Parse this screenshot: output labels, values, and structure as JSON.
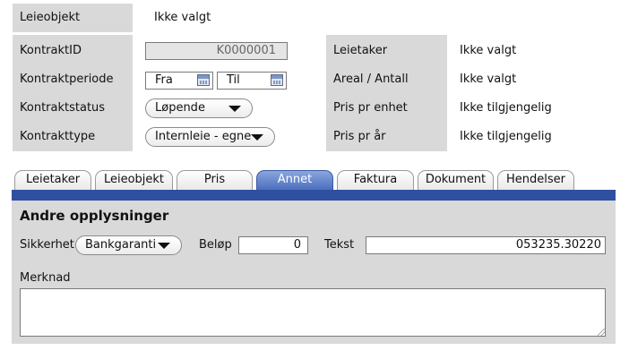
{
  "top": {
    "leieobjekt_label": "Leieobjekt",
    "leieobjekt_value": "Ikke valgt"
  },
  "left": {
    "kontraktid_label": "KontraktID",
    "kontraktid_value": "K0000001",
    "periode_label": "Kontraktperiode",
    "fra_label": "Fra",
    "til_label": "Til",
    "status_label": "Kontraktstatus",
    "status_value": "Løpende",
    "type_label": "Kontrakttype",
    "type_value": "Internleie - egne"
  },
  "right": {
    "leietaker_label": "Leietaker",
    "leietaker_value": "Ikke valgt",
    "areal_label": "Areal / Antall",
    "areal_value": "Ikke valgt",
    "pris_enhet_label": "Pris pr enhet",
    "pris_enhet_value": "Ikke tilgjengelig",
    "pris_aar_label": "Pris pr år",
    "pris_aar_value": "Ikke tilgjengelig"
  },
  "tabs": [
    {
      "label": "Leietaker"
    },
    {
      "label": "Leieobjekt"
    },
    {
      "label": "Pris"
    },
    {
      "label": "Annet"
    },
    {
      "label": "Faktura"
    },
    {
      "label": "Dokument"
    },
    {
      "label": "Hendelser"
    }
  ],
  "active_tab": "Annet",
  "panel": {
    "title": "Andre opplysninger",
    "sikkerhet_label": "Sikkerhet",
    "sikkerhet_value": "Bankgaranti",
    "belop_label": "Beløp",
    "belop_value": "0",
    "tekst_label": "Tekst",
    "tekst_value": "053235.30220",
    "merknad_label": "Merknad",
    "merknad_value": ""
  },
  "colors": {
    "tab_bar": "#2f4f9f",
    "active_tab": "#4c6fbf",
    "panel_bg": "#d9d9d9"
  }
}
